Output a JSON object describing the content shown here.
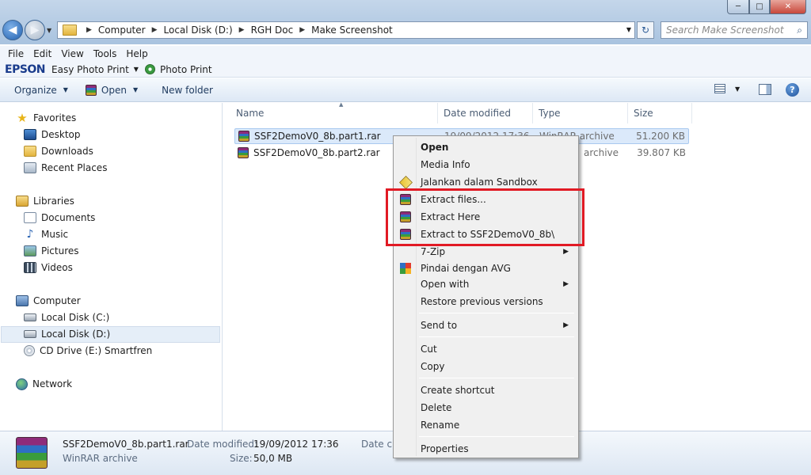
{
  "window": {
    "address": [
      "Computer",
      "Local Disk (D:)",
      "RGH Doc",
      "Make Screenshot"
    ],
    "search_placeholder": "Search Make Screenshot",
    "controls": {
      "minimize": "─",
      "maximize": "□",
      "close": "✕"
    }
  },
  "menubar": [
    "File",
    "Edit",
    "View",
    "Tools",
    "Help"
  ],
  "epson": {
    "brand": "EPSON",
    "easy_photo_print": "Easy Photo Print",
    "photo_print": "Photo Print"
  },
  "toolbar": {
    "organize": "Organize",
    "open": "Open",
    "new_folder": "New folder"
  },
  "nav": {
    "favorites": "Favorites",
    "desktop": "Desktop",
    "downloads": "Downloads",
    "recent_places": "Recent Places",
    "libraries": "Libraries",
    "documents": "Documents",
    "music": "Music",
    "pictures": "Pictures",
    "videos": "Videos",
    "computer": "Computer",
    "local_c": "Local Disk (C:)",
    "local_d": "Local Disk (D:)",
    "cd_drive": "CD Drive (E:) Smartfren",
    "network": "Network"
  },
  "columns": {
    "name": "Name",
    "date": "Date modified",
    "type": "Type",
    "size": "Size"
  },
  "files": [
    {
      "name": "SSF2DemoV0_8b.part1.rar",
      "date": "19/09/2012 17:36",
      "type": "WinRAR archive",
      "size": "51.200 KB"
    },
    {
      "name": "SSF2DemoV0_8b.part2.rar",
      "date": "",
      "type": "archive",
      "size": "39.807 KB"
    }
  ],
  "context_menu": {
    "open": "Open",
    "media_info": "Media Info",
    "sandbox": "Jalankan dalam Sandbox",
    "extract_files": "Extract files...",
    "extract_here": "Extract Here",
    "extract_to": "Extract to SSF2DemoV0_8b\\",
    "seven_zip": "7-Zip",
    "avg": "Pindai dengan AVG",
    "open_with": "Open with",
    "restore": "Restore previous versions",
    "send_to": "Send to",
    "cut": "Cut",
    "copy": "Copy",
    "create_shortcut": "Create shortcut",
    "delete": "Delete",
    "rename": "Rename",
    "properties": "Properties"
  },
  "details": {
    "filename": "SSF2DemoV0_8b.part1.rar",
    "type": "WinRAR archive",
    "date_label": "Date modified:",
    "date_value": "19/09/2012 17:36",
    "size_label": "Size:",
    "size_value": "50,0 MB",
    "created_label": "Date cre"
  }
}
